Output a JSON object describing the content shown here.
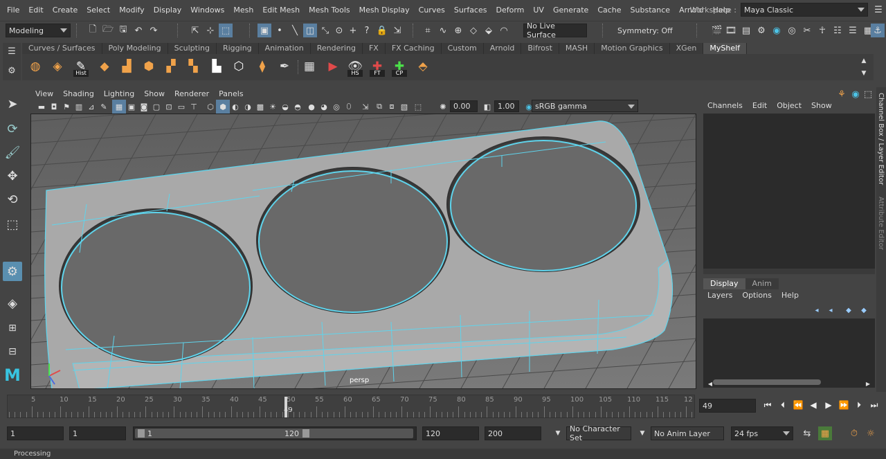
{
  "menubar": {
    "items": [
      "File",
      "Edit",
      "Create",
      "Select",
      "Modify",
      "Display",
      "Windows",
      "Mesh",
      "Edit Mesh",
      "Mesh Tools",
      "Mesh Display",
      "Curves",
      "Surfaces",
      "Deform",
      "UV",
      "Generate",
      "Cache",
      "Substance",
      "Arnold",
      "Help"
    ],
    "workspace_label": "Workspace :",
    "workspace_value": "Maya Classic"
  },
  "statusline": {
    "mode": "Modeling",
    "live_surface": "No Live Surface",
    "symmetry": "Symmetry: Off"
  },
  "shelf": {
    "tabs": [
      "Curves / Surfaces",
      "Poly Modeling",
      "Sculpting",
      "Rigging",
      "Animation",
      "Rendering",
      "FX",
      "FX Caching",
      "Custom",
      "Arnold",
      "Bifrost",
      "MASH",
      "Motion Graphics",
      "XGen",
      "MyShelf"
    ],
    "active_tab": "MyShelf",
    "icon_labels": {
      "hist": "Hist",
      "hs": "HS",
      "ft": "FT",
      "cp": "CP"
    }
  },
  "panel": {
    "menu": [
      "View",
      "Shading",
      "Lighting",
      "Show",
      "Renderer",
      "Panels"
    ],
    "exposure": "0.00",
    "gamma": "1.00",
    "colorspace": "sRGB gamma",
    "camera_label": "persp"
  },
  "channelbox": {
    "menu": [
      "Channels",
      "Edit",
      "Object",
      "Show"
    ],
    "side_tab_1": "Channel Box / Layer Editor",
    "side_tab_2": "Attribute Editor"
  },
  "layers": {
    "tabs": [
      "Display",
      "Anim"
    ],
    "menu": [
      "Layers",
      "Options",
      "Help"
    ]
  },
  "timeslider": {
    "ticks": [
      "5",
      "10",
      "15",
      "20",
      "25",
      "30",
      "35",
      "40",
      "45",
      "50",
      "55",
      "60",
      "65",
      "70",
      "75",
      "80",
      "85",
      "90",
      "95",
      "100",
      "105",
      "110",
      "115",
      "12"
    ],
    "current_frame": "49",
    "current_field": "49"
  },
  "range": {
    "start": "1",
    "playback_start": "1",
    "slider_start": "1",
    "slider_end": "120",
    "playback_end": "120",
    "end": "200",
    "character_set": "No Character Set",
    "anim_layer": "No Anim Layer",
    "fps": "24 fps"
  },
  "help_line": "Processing",
  "colors": {
    "wire": "#5fd4ec",
    "viewport_bg": "#6a6a6a",
    "mesh": "#a8a8a8",
    "accent": "#52a8c9"
  }
}
